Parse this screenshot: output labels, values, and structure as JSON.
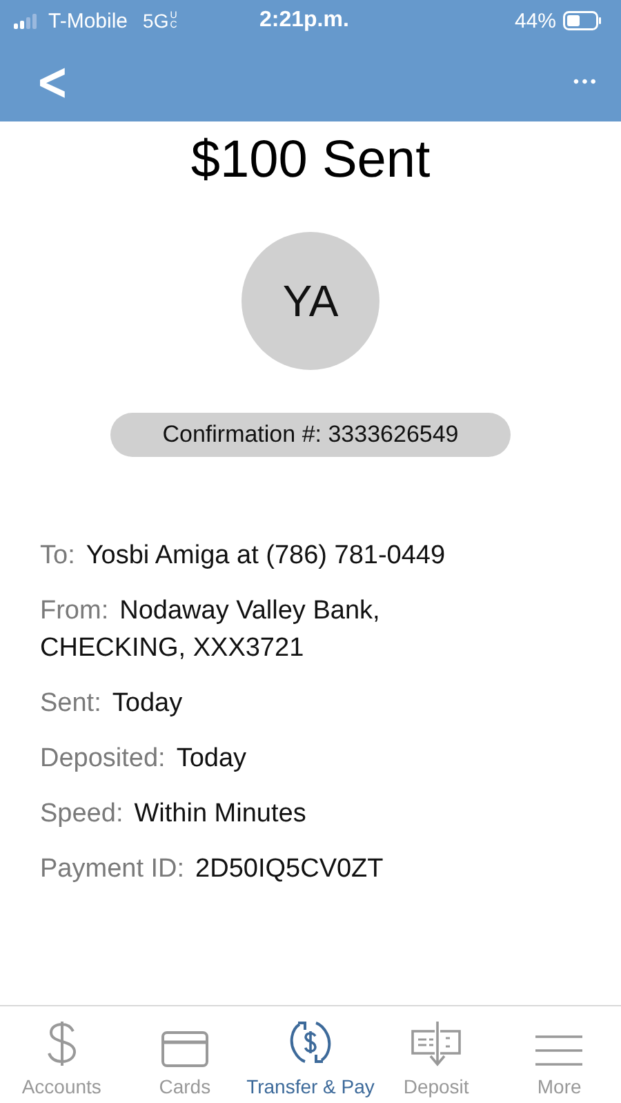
{
  "status_bar": {
    "carrier": "T-Mobile",
    "network": "5G",
    "network_badge": "UC",
    "time": "2:21p.m.",
    "battery": "44%"
  },
  "nav": {
    "back": "<",
    "more": "•••"
  },
  "title": "$100 Sent",
  "avatar": {
    "initials": "YA"
  },
  "confirmation": "Confirmation #: 3333626549",
  "details": [
    {
      "label": "To:",
      "value": "Yosbi Amiga at (786) 781-0449"
    },
    {
      "label": "From:",
      "value": "Nodaway Valley Bank, CHECKING, XXX3721"
    },
    {
      "label": "Sent:",
      "value": "Today"
    },
    {
      "label": "Deposited:",
      "value": "Today"
    },
    {
      "label": "Speed:",
      "value": "Within Minutes"
    },
    {
      "label": "Payment ID:",
      "value": "2D50IQ5CV0ZT"
    }
  ],
  "tabs": [
    {
      "label": "Accounts",
      "kind": "dollar",
      "selected": false
    },
    {
      "label": "Cards",
      "kind": "card",
      "selected": false
    },
    {
      "label": "Transfer & Pay",
      "kind": "transfer",
      "selected": true
    },
    {
      "label": "Deposit",
      "kind": "deposit",
      "selected": false
    },
    {
      "label": "More",
      "kind": "menu",
      "selected": false
    }
  ]
}
